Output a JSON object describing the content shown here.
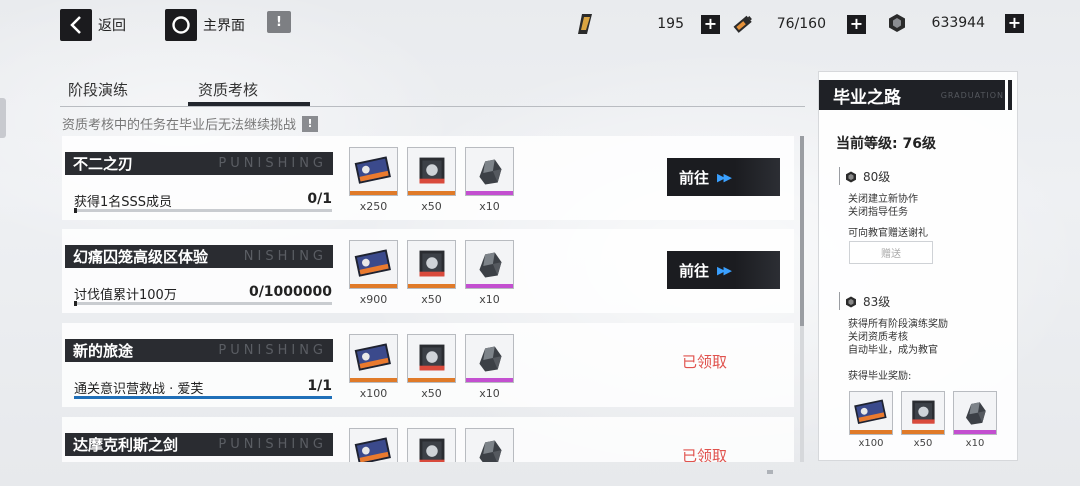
{
  "topbar": {
    "back_label": "返回",
    "home_label": "主界面",
    "info_icon": "!",
    "resources": [
      {
        "icon": "ticket-icon",
        "value": "195",
        "plus": "+"
      },
      {
        "icon": "battery-icon",
        "value": "76/160",
        "plus": "+"
      },
      {
        "icon": "coin-icon",
        "value": "633944",
        "plus": "+"
      }
    ]
  },
  "tabs": [
    {
      "label": "阶段演练",
      "active": false
    },
    {
      "label": "资质考核",
      "active": true
    }
  ],
  "notice": {
    "text": "资质考核中的任务在毕业后无法继续挑战",
    "icon": "!"
  },
  "tasks": [
    {
      "title": "不二之刃",
      "watermark": "PUNISHING",
      "desc": "获得1名SSS成员",
      "progress": "0/1",
      "progress_fraction": 0.0,
      "rewards": [
        {
          "qty": "x250",
          "icon": "supply-card-icon"
        },
        {
          "qty": "x50",
          "icon": "chip-icon"
        },
        {
          "qty": "x10",
          "icon": "ore-icon"
        }
      ],
      "action": {
        "type": "go",
        "label": "前往",
        "arrow": "▶▶"
      }
    },
    {
      "title": "幻痛囚笼高级区体验",
      "watermark": "NISHING",
      "desc": "讨伐值累计100万",
      "progress": "0/1000000",
      "progress_fraction": 0.0,
      "rewards": [
        {
          "qty": "x900",
          "icon": "supply-card-icon"
        },
        {
          "qty": "x50",
          "icon": "chip-icon"
        },
        {
          "qty": "x10",
          "icon": "ore-icon"
        }
      ],
      "action": {
        "type": "go",
        "label": "前往",
        "arrow": "▶▶"
      }
    },
    {
      "title": "新的旅途",
      "watermark": "PUNISHING",
      "desc": "通关意识营救战 · 爱芙",
      "progress": "1/1",
      "progress_fraction": 1.0,
      "rewards": [
        {
          "qty": "x100",
          "icon": "supply-card-icon"
        },
        {
          "qty": "x50",
          "icon": "chip-icon"
        },
        {
          "qty": "x10",
          "icon": "ore-icon"
        }
      ],
      "action": {
        "type": "claimed",
        "label": "已领取"
      }
    },
    {
      "title": "达摩克利斯之剑",
      "watermark": "PUNISHING",
      "desc": "",
      "progress": "",
      "progress_fraction": 0.0,
      "rewards": [
        {
          "qty": "",
          "icon": "supply-card-icon"
        },
        {
          "qty": "",
          "icon": "chip-icon"
        },
        {
          "qty": "",
          "icon": "ore-icon"
        }
      ],
      "action": {
        "type": "claimed",
        "label": "已领取"
      }
    }
  ],
  "panel": {
    "title": "毕业之路",
    "subtitle": "GRADUATION",
    "current_level": "当前等级: 76级",
    "milestones": [
      {
        "level": "80级",
        "lines": [
          "关闭建立新协作",
          "关闭指导任务"
        ],
        "extra": "可向教官赠送谢礼",
        "button": "赠送"
      },
      {
        "level": "83级",
        "lines": [
          "获得所有阶段演练奖励",
          "关闭资质考核",
          "自动毕业，成为教官"
        ],
        "extra": "获得毕业奖励:"
      }
    ],
    "grad_rewards": [
      {
        "qty": "x100",
        "icon": "supply-card-icon"
      },
      {
        "qty": "x50",
        "icon": "chip-icon"
      },
      {
        "qty": "x10",
        "icon": "ore-icon"
      }
    ]
  },
  "colors": {
    "accent_blue": "#1f6fb8",
    "claimed_red": "#e0524d",
    "dark": "#1b1b1e"
  }
}
